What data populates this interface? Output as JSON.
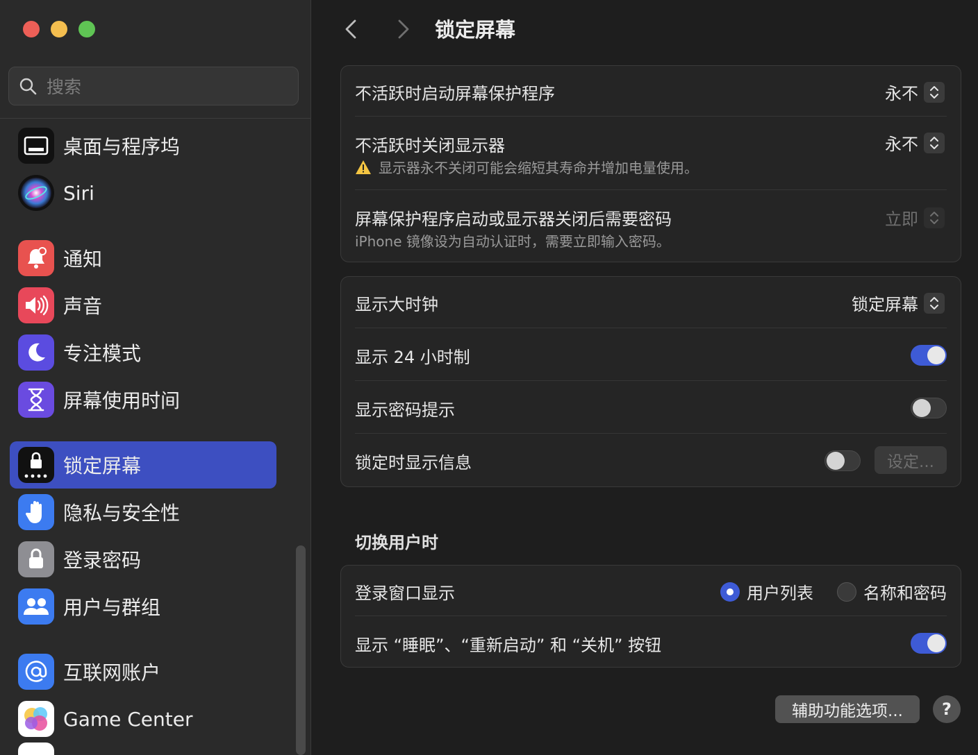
{
  "window": {
    "traffic_lights": [
      {
        "name": "close",
        "color": "#ed5f57"
      },
      {
        "name": "minimize",
        "color": "#f4be4f"
      },
      {
        "name": "zoom",
        "color": "#5fc454"
      }
    ]
  },
  "search": {
    "placeholder": "搜索"
  },
  "sidebar": {
    "items": [
      {
        "label": "桌面与程序坞",
        "icon": "dock-icon",
        "color": "#111111"
      },
      {
        "label": "Siri",
        "icon": "siri-icon",
        "color": "#1c1c2e"
      },
      {
        "label": "通知",
        "icon": "bell-icon",
        "color": "#e8524f"
      },
      {
        "label": "声音",
        "icon": "speaker-icon",
        "color": "#e8485a"
      },
      {
        "label": "专注模式",
        "icon": "moon-icon",
        "color": "#5b4ce0"
      },
      {
        "label": "屏幕使用时间",
        "icon": "hourglass-icon",
        "color": "#6a4be0"
      },
      {
        "label": "锁定屏幕",
        "icon": "lock-screen-icon",
        "color": "#111111",
        "active": true
      },
      {
        "label": "隐私与安全性",
        "icon": "hand-icon",
        "color": "#3c7bf0"
      },
      {
        "label": "登录密码",
        "icon": "lock-icon",
        "color": "#8e8e93"
      },
      {
        "label": "用户与群组",
        "icon": "users-icon",
        "color": "#3c7bf0"
      },
      {
        "label": "互联网账户",
        "icon": "at-icon",
        "color": "#3c7bf0"
      },
      {
        "label": "Game Center",
        "icon": "game-center-icon",
        "color": "#ffffff"
      }
    ]
  },
  "main": {
    "title": "锁定屏幕",
    "group1": {
      "screensaver": {
        "label": "不活跃时启动屏幕保护程序",
        "value": "永不"
      },
      "display_off": {
        "label": "不活跃时关闭显示器",
        "value": "永不",
        "warning": "显示器永不关闭可能会缩短其寿命并增加电量使用。"
      },
      "password": {
        "label": "屏幕保护程序启动或显示器关闭后需要密码",
        "value": "立即",
        "note": "iPhone 镜像设为自动认证时，需要立即输入密码。"
      }
    },
    "group2": {
      "large_clock": {
        "label": "显示大时钟",
        "value": "锁定屏幕"
      },
      "hour24": {
        "label": "显示 24 小时制",
        "on": true
      },
      "password_hint": {
        "label": "显示密码提示",
        "on": false
      },
      "lock_message": {
        "label": "锁定时显示信息",
        "on": false,
        "button": "设定..."
      }
    },
    "switch_user": {
      "title": "切换用户时",
      "login_window": {
        "label": "登录窗口显示",
        "options": [
          "用户列表",
          "名称和密码"
        ],
        "selected": "用户列表"
      },
      "power_buttons": {
        "label": "显示 “睡眠”、“重新启动” 和 “关机” 按钮",
        "on": true
      }
    },
    "accessibility_button": "辅助功能选项...",
    "help_button": "?"
  }
}
